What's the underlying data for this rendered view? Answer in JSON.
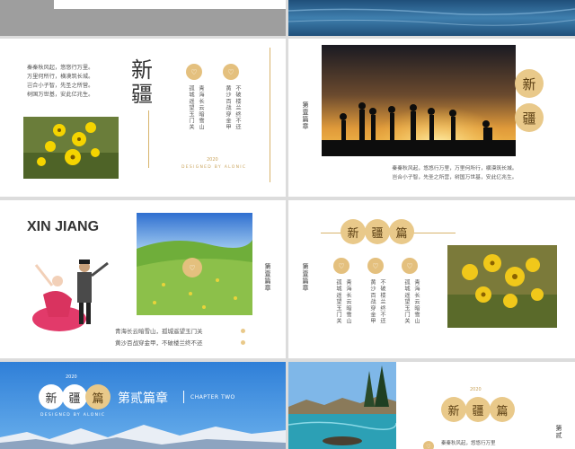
{
  "slide2": {
    "title": "新\n疆",
    "poem": [
      "秦秦秋风起，悠悠行万里。",
      "万里何所行，横漠筑长城。",
      "岂合小子智，先圣之所营。",
      "树国万世基，安此亿兆生。"
    ],
    "col1": [
      "孤城遥望玉门关",
      "青海长云暗雪山"
    ],
    "col2": [
      "黄沙百战穿金甲",
      "不破楼兰终不还"
    ],
    "year": "2020",
    "designed": "DESIGNED BY ALONIC"
  },
  "slide3": {
    "vertical_label": "第壹篇章",
    "badge1": "新",
    "badge2": "疆",
    "poem": [
      "秦秦秋风起，悠悠行万里，万里何所行，横漠筑长城。",
      "岂合小子智，先圣之所营，树国万世基，安此亿兆生。"
    ]
  },
  "slide4": {
    "title": "XIN JIANG",
    "vertical_label": "第壹篇章",
    "poem": [
      "青海长云暗雪山，孤城遥望玉门关",
      "黄沙百战穿金甲，不破楼兰终不还"
    ]
  },
  "slide5": {
    "vertical_label": "第壹篇章",
    "badges": [
      "新",
      "疆",
      "篇"
    ],
    "col1": [
      "孤城遥望玉门关",
      "青海长云暗雪山"
    ],
    "col2": [
      "黄沙百战穿金甲",
      "不破楼兰终不还"
    ],
    "col3": [
      "孤城遥望玉门关",
      "青海长云暗雪山"
    ]
  },
  "slide6": {
    "year": "2020",
    "badges": [
      "新",
      "疆",
      "篇"
    ],
    "designed": "DESIGNED BY ALONIC",
    "chapter": "第贰篇章",
    "chapter_en": "CHAPTER TWO"
  },
  "slide7": {
    "year": "2020",
    "badges": [
      "新",
      "疆",
      "篇"
    ],
    "poem": "秦秦秋风起，悠悠行万里",
    "vertical_label": "第贰"
  },
  "colors": {
    "gold": "#c9a35b",
    "badge": "#e9c98a",
    "background": "#dcdcdc"
  }
}
